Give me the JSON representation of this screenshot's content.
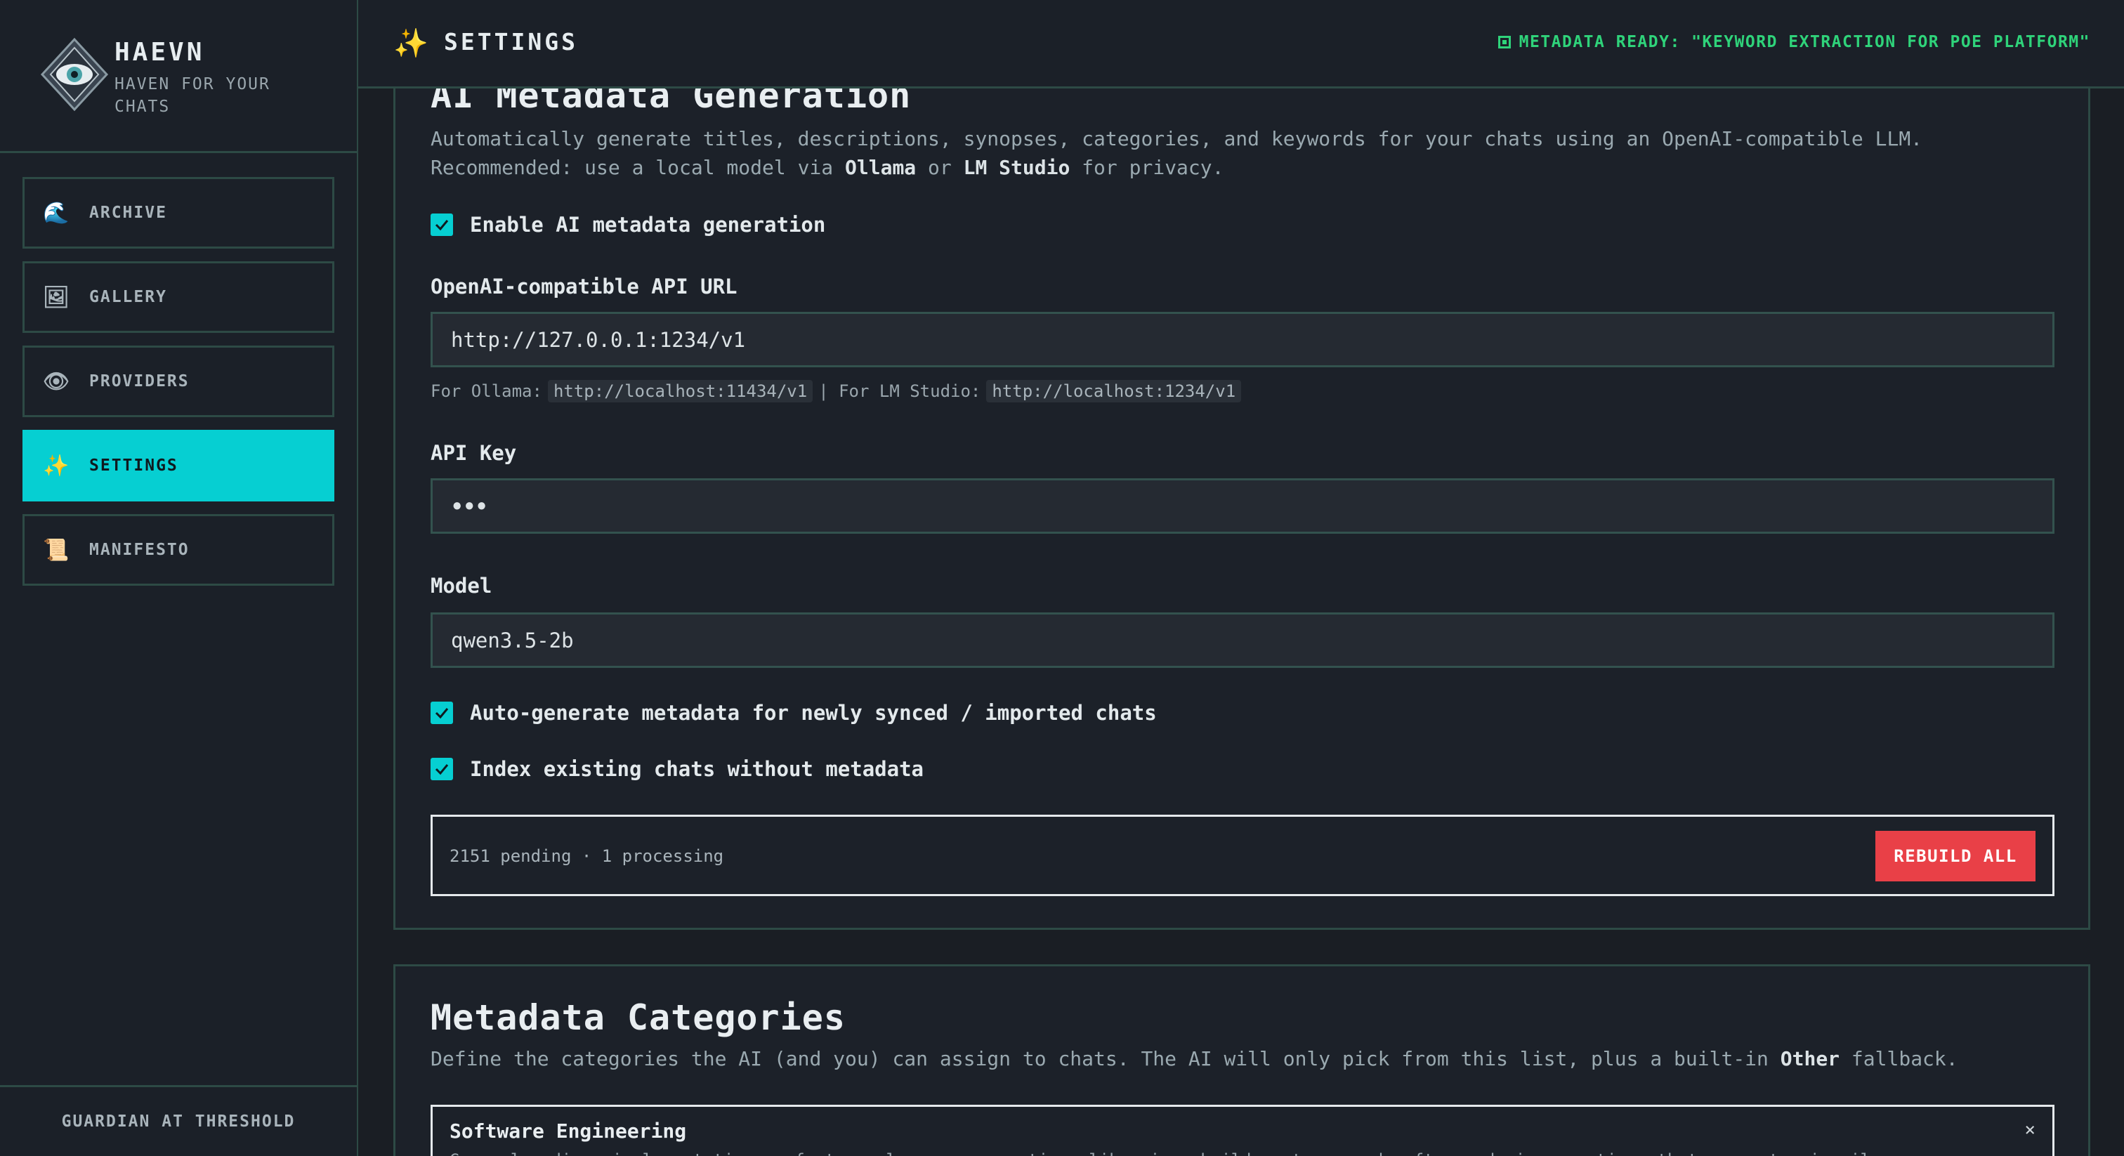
{
  "app": {
    "name": "HAEVN",
    "tagline": "HAVEN FOR YOUR CHATS",
    "footer": "GUARDIAN AT THRESHOLD"
  },
  "nav": {
    "items": [
      {
        "label": "ARCHIVE",
        "icon": "wave-icon",
        "glyph": "🌊",
        "active": false
      },
      {
        "label": "GALLERY",
        "icon": "picture-icon",
        "glyph": "🖼",
        "active": false
      },
      {
        "label": "PROVIDERS",
        "icon": "eye-icon",
        "glyph": "👁",
        "active": false
      },
      {
        "label": "SETTINGS",
        "icon": "sparkles-icon",
        "glyph": "✨",
        "active": true
      },
      {
        "label": "MANIFESTO",
        "icon": "scroll-icon",
        "glyph": "📜",
        "active": false
      }
    ]
  },
  "header": {
    "title": "SETTINGS",
    "icon": "sparkles-icon",
    "glyph": "✨",
    "status": "METADATA READY: \"KEYWORD EXTRACTION FOR POE PLATFORM\""
  },
  "ai_section": {
    "title": "AI Metadata Generation",
    "desc_line1": "Automatically generate titles, descriptions, synopses, categories, and keywords for your chats using an OpenAI-compatible LLM.",
    "desc_line2_pre": "Recommended: use a local model via ",
    "desc_ollama": "Ollama",
    "desc_or": " or ",
    "desc_lmstudio": "LM Studio",
    "desc_line2_post": " for privacy.",
    "enable_label": "Enable AI metadata generation",
    "enable_checked": true,
    "api_url_label": "OpenAI-compatible API URL",
    "api_url_value": "http://127.0.0.1:1234/v1",
    "hint_ollama_pre": "For Ollama:",
    "hint_ollama_url": "http://localhost:11434/v1",
    "hint_sep": "| For LM Studio:",
    "hint_lmstudio_url": "http://localhost:1234/v1",
    "api_key_label": "API Key",
    "api_key_value": "•••",
    "model_label": "Model",
    "model_value": "qwen3.5-2b",
    "auto_label": "Auto-generate metadata for newly synced / imported chats",
    "auto_checked": true,
    "index_label": "Index existing chats without metadata",
    "index_checked": true,
    "queue_status": "2151 pending · 1 processing",
    "rebuild_label": "REBUILD ALL"
  },
  "categories_section": {
    "title": "Metadata Categories",
    "desc_pre": "Define the categories the AI (and you) can assign to chats. The AI will only pick from this list, plus a built-in ",
    "desc_other": "Other",
    "desc_post": " fallback.",
    "items": [
      {
        "name": "Software Engineering",
        "description": "General coding, implementation, refactors, language semantics, libraries, build systems, and software design questions that are not primarily"
      }
    ],
    "remove_glyph": "×"
  },
  "colors": {
    "accent": "#06cfd2",
    "status_green": "#2fd37a",
    "danger": "#e94047",
    "border": "#2d4a45",
    "bg": "#1a1e24"
  }
}
